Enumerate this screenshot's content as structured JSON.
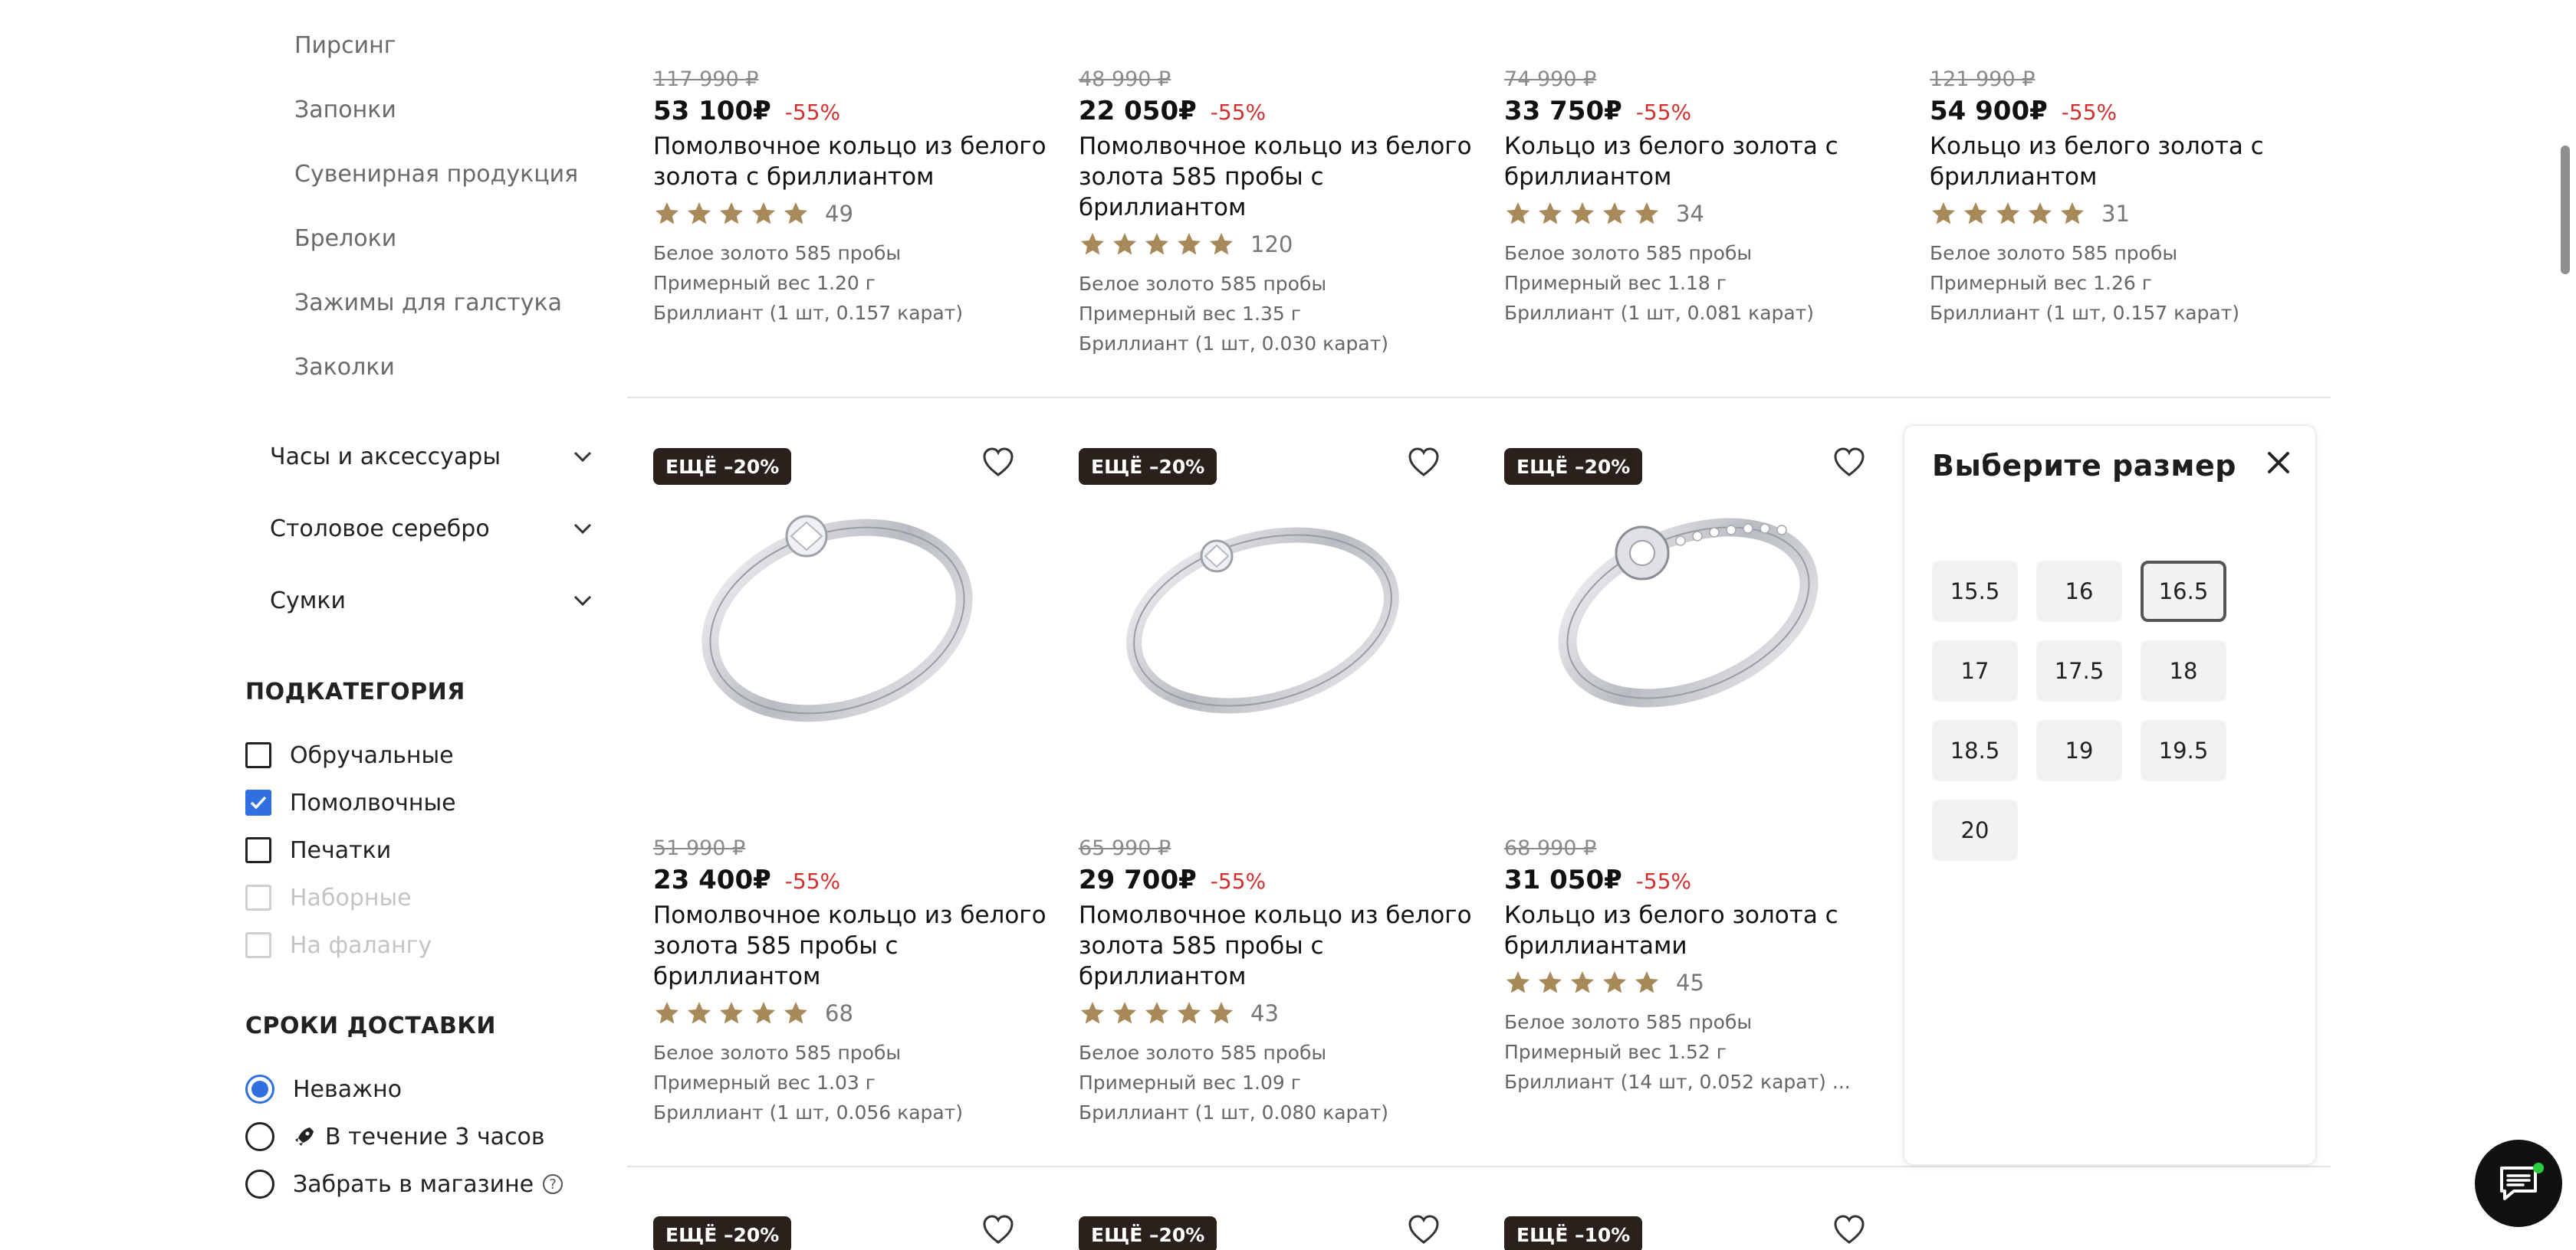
{
  "sidebar": {
    "sublinks": [
      "Пирсинг",
      "Запонки",
      "Сувенирная продукция",
      "Брелоки",
      "Зажимы для галстука",
      "Заколки"
    ],
    "categories": [
      "Часы и аксессуары",
      "Столовое серебро",
      "Сумки"
    ],
    "subcategory": {
      "title": "ПОДКАТЕГОРИЯ",
      "options": [
        {
          "label": "Обручальные",
          "checked": false,
          "disabled": false
        },
        {
          "label": "Помолвочные",
          "checked": true,
          "disabled": false
        },
        {
          "label": "Печатки",
          "checked": false,
          "disabled": false
        },
        {
          "label": "Наборные",
          "checked": false,
          "disabled": true
        },
        {
          "label": "На фалангу",
          "checked": false,
          "disabled": true
        }
      ]
    },
    "delivery": {
      "title": "СРОКИ ДОСТАВКИ",
      "options": [
        {
          "label": "Неважно",
          "checked": true
        },
        {
          "label": "В течение 3 часов",
          "checked": false,
          "icon": "rocket-icon"
        },
        {
          "label": "Забрать в магазине",
          "checked": false,
          "icon": "help-icon"
        }
      ]
    }
  },
  "products_top": [
    {
      "old_price": "117 990 ₽",
      "price": "53 100₽",
      "discount": "-55%",
      "title": "Помолвочное кольцо из белого золота с бриллиантом",
      "rating": 5,
      "reviews": "49",
      "specs": [
        "Белое золото 585 пробы",
        "Примерный вес 1.20 г",
        "Бриллиант (1 шт, 0.157 карат)"
      ]
    },
    {
      "old_price": "48 990 ₽",
      "price": "22 050₽",
      "discount": "-55%",
      "title": "Помолвочное кольцо из белого золота 585 пробы с бриллиантом",
      "rating": 5,
      "reviews": "120",
      "specs": [
        "Белое золото 585 пробы",
        "Примерный вес 1.35 г",
        "Бриллиант (1 шт, 0.030 карат)"
      ]
    },
    {
      "old_price": "74 990 ₽",
      "price": "33 750₽",
      "discount": "-55%",
      "title": "Кольцо из белого золота с бриллиантом",
      "rating": 5,
      "reviews": "34",
      "specs": [
        "Белое золото 585 пробы",
        "Примерный вес 1.18 г",
        "Бриллиант (1 шт, 0.081 карат)"
      ]
    },
    {
      "old_price": "121 990 ₽",
      "price": "54 900₽",
      "discount": "-55%",
      "title": "Кольцо из белого золота с бриллиантом",
      "rating": 5,
      "reviews": "31",
      "specs": [
        "Белое золото 585 пробы",
        "Примерный вес 1.26 г",
        "Бриллиант (1 шт, 0.157 карат)"
      ]
    }
  ],
  "products_mid": [
    {
      "badge": "ЕЩЁ –20%",
      "old_price": "51 990 ₽",
      "price": "23 400₽",
      "discount": "-55%",
      "title": "Помолвочное кольцо из белого золота 585 пробы с бриллиантом",
      "rating": 5,
      "reviews": "68",
      "specs": [
        "Белое золото 585 пробы",
        "Примерный вес 1.03 г",
        "Бриллиант (1 шт, 0.056 карат)"
      ]
    },
    {
      "badge": "ЕЩЁ –20%",
      "old_price": "65 990 ₽",
      "price": "29 700₽",
      "discount": "-55%",
      "title": "Помолвочное кольцо из белого золота 585 пробы с бриллиантом",
      "rating": 5,
      "reviews": "43",
      "specs": [
        "Белое золото 585 пробы",
        "Примерный вес 1.09 г",
        "Бриллиант (1 шт, 0.080 карат)"
      ]
    },
    {
      "badge": "ЕЩЁ –20%",
      "old_price": "68 990 ₽",
      "price": "31 050₽",
      "discount": "-55%",
      "title": "Кольцо из белого золота с бриллиантами",
      "rating": 5,
      "reviews": "45",
      "specs": [
        "Белое золото 585 пробы",
        "Примерный вес 1.52 г",
        "Бриллиант (14 шт, 0.052 карат) ..."
      ]
    }
  ],
  "products_bottom_badges": [
    "ЕЩЁ –20%",
    "ЕЩЁ –20%",
    "ЕЩЁ –10%"
  ],
  "size_picker": {
    "title": "Выберите размер",
    "sizes": [
      "15.5",
      "16",
      "16.5",
      "17",
      "17.5",
      "18",
      "18.5",
      "19",
      "19.5",
      "20"
    ],
    "selected": "16.5"
  },
  "colors": {
    "star": "#a88a5a",
    "discount": "#d32f2f",
    "badge_bg": "#2a211c",
    "accent": "#2f6fdf"
  }
}
